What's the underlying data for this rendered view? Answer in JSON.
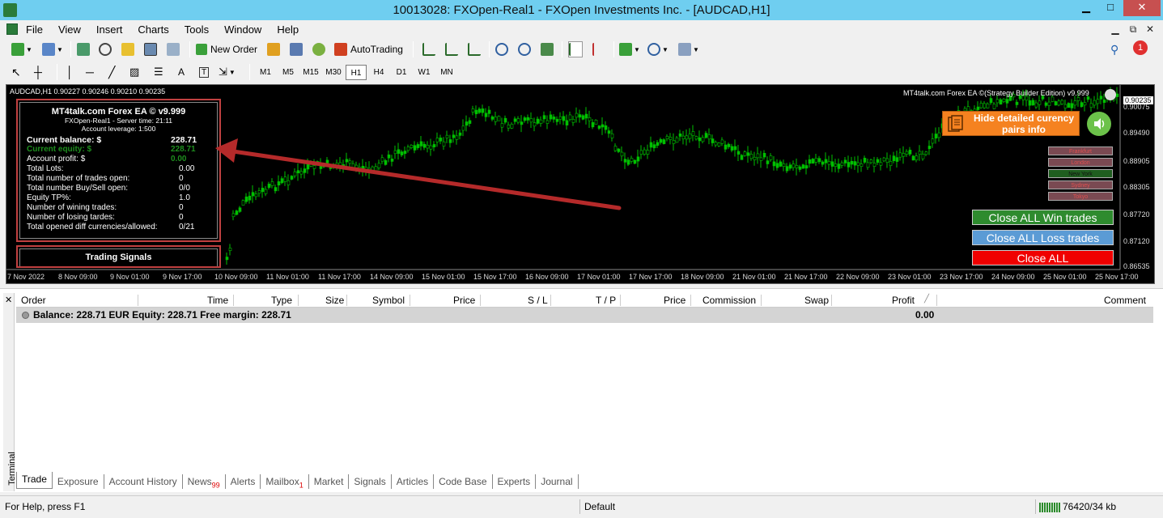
{
  "window": {
    "title": "10013028: FXOpen-Real1 - FXOpen Investments Inc. - [AUDCAD,H1]",
    "min": "▁",
    "max": "□",
    "close": "✕"
  },
  "menu": {
    "items": [
      "File",
      "View",
      "Insert",
      "Charts",
      "Tools",
      "Window",
      "Help"
    ]
  },
  "toolbar": {
    "new_order": "New Order",
    "autotrading": "AutoTrading",
    "text_tool": "A"
  },
  "timeframes": {
    "items": [
      "M1",
      "M5",
      "M15",
      "M30",
      "H1",
      "H4",
      "D1",
      "W1",
      "MN"
    ],
    "active": "H1"
  },
  "chart": {
    "header": "AUDCAD,H1  0.90227 0.90246 0.90210 0.90235",
    "ea_label": "MT4talk.com Forex EA ©(Strategy Builder Edition) v9.999",
    "current_price": "0.90235",
    "price_labels": [
      "0.90075",
      "0.89490",
      "0.88905",
      "0.88305",
      "0.87720",
      "0.87120",
      "0.86535"
    ],
    "time_labels": [
      "7 Nov 2022",
      "8 Nov 09:00",
      "9 Nov 01:00",
      "9 Nov 17:00",
      "10 Nov 09:00",
      "11 Nov 01:00",
      "11 Nov 17:00",
      "14 Nov 09:00",
      "15 Nov 01:00",
      "15 Nov 17:00",
      "16 Nov 09:00",
      "17 Nov 01:00",
      "17 Nov 17:00",
      "18 Nov 09:00",
      "21 Nov 01:00",
      "21 Nov 17:00",
      "22 Nov 09:00",
      "23 Nov 01:00",
      "23 Nov 17:00",
      "24 Nov 09:00",
      "25 Nov 01:00",
      "25 Nov 17:00"
    ]
  },
  "info": {
    "title": "MT4talk.com Forex EA © v9.999",
    "server": "FXOpen-Real1 - Server time: 21:11",
    "leverage": "Account leverage: 1:500",
    "rows": [
      {
        "label": "Current balance: $",
        "value": "228.71"
      },
      {
        "label": "Current equity: $",
        "value": "228.71"
      },
      {
        "label": "Account profit: $",
        "value": "0.00"
      },
      {
        "label": "Total Lots:",
        "value": "0.00"
      },
      {
        "label": "Total number of trades open:",
        "value": "0"
      },
      {
        "label": "Total number Buy/Sell open:",
        "value": "0/0"
      },
      {
        "label": "Equity  TP%:",
        "value": "1.0"
      },
      {
        "label": "Number of wining trades:",
        "value": "0"
      },
      {
        "label": "Number of losing tardes:",
        "value": "0"
      },
      {
        "label": "Total opened diff currencies/allowed:",
        "value": "0/21"
      }
    ],
    "signals": "Trading Signals"
  },
  "controls": {
    "hide_info": "Hide detailed curency pairs info",
    "sessions": [
      "Frankfurt",
      "London",
      "New York",
      "Sydney",
      "Tokyo"
    ],
    "close_win": "Close ALL Win trades",
    "close_loss": "Close ALL Loss trades",
    "close_all": "Close ALL"
  },
  "terminal": {
    "side_label": "Terminal",
    "columns": [
      "Order",
      "Time",
      "Type",
      "Size",
      "Symbol",
      "Price",
      "S / L",
      "T / P",
      "Price",
      "Commission",
      "Swap",
      "Profit",
      "Comment"
    ],
    "balance_row": "Balance: 228.71 EUR  Equity: 228.71  Free margin: 228.71",
    "profit_total": "0.00",
    "tabs": [
      {
        "label": "Trade",
        "badge": ""
      },
      {
        "label": "Exposure",
        "badge": ""
      },
      {
        "label": "Account History",
        "badge": ""
      },
      {
        "label": "News",
        "badge": "99"
      },
      {
        "label": "Alerts",
        "badge": ""
      },
      {
        "label": "Mailbox",
        "badge": "1"
      },
      {
        "label": "Market",
        "badge": ""
      },
      {
        "label": "Signals",
        "badge": ""
      },
      {
        "label": "Articles",
        "badge": ""
      },
      {
        "label": "Code Base",
        "badge": ""
      },
      {
        "label": "Experts",
        "badge": ""
      },
      {
        "label": "Journal",
        "badge": ""
      }
    ],
    "active_tab": "Trade"
  },
  "status": {
    "help": "For Help, press F1",
    "profile": "Default",
    "traffic": "76420/34 kb"
  },
  "colors": {
    "title_bar": "#6fcef0",
    "candle_up": "#00c000",
    "candle_down": "#00c000",
    "arrow": "#b52a2a"
  },
  "icons": [
    "app-icon",
    "new-chart-icon",
    "profiles-icon",
    "new-order-icon",
    "autotrading-icon",
    "zoom-in-icon",
    "zoom-out-icon",
    "search-icon",
    "notification-icon",
    "speaker-icon",
    "document-icon",
    "cursor-icon",
    "crosshair-icon"
  ]
}
